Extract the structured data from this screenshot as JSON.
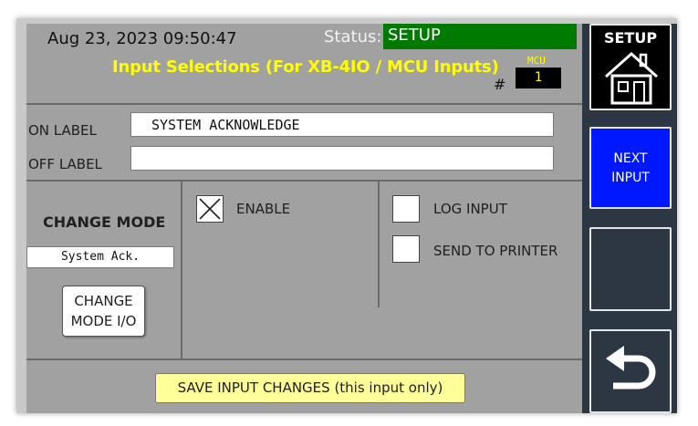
{
  "header": {
    "datetime": "Aug 23, 2023 09:50:47",
    "status_label": "Status:",
    "status_value": "SETUP",
    "title": "Input Selections (For XB-4IO / MCU Inputs)",
    "hash_sign": "#",
    "mcu_label": "MCU",
    "mcu_number": "1"
  },
  "labels": {
    "on_label": "ON LABEL",
    "on_value": "SYSTEM ACKNOWLEDGE",
    "off_label": "OFF LABEL",
    "off_value": ""
  },
  "change_mode": {
    "title": "CHANGE MODE",
    "value": "System Ack.",
    "button_line1": "CHANGE",
    "button_line2": "MODE I/O"
  },
  "options": {
    "enable": {
      "label": "ENABLE",
      "checked": true
    },
    "log_input": {
      "label": "LOG INPUT",
      "checked": false
    },
    "send_to_printer": {
      "label": "SEND TO PRINTER",
      "checked": false
    }
  },
  "save_button": "SAVE INPUT CHANGES (this input only)",
  "sidebar": {
    "setup_label": "SETUP",
    "next_line1": "NEXT",
    "next_line2": "INPUT"
  },
  "colors": {
    "panel": "#a1a1a1",
    "status_green": "#007a00",
    "title_yellow": "#ffff00",
    "sidebar": "#2d3643",
    "next_blue": "#0018ff",
    "save_yellow": "#ffff99"
  },
  "icons": [
    "home-icon",
    "back-arrow-icon",
    "checkmark-x-icon"
  ]
}
